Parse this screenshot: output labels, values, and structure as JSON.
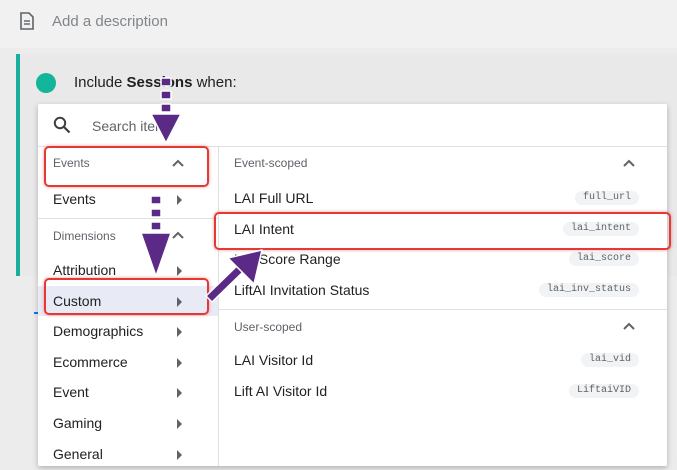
{
  "description": {
    "placeholder": "Add a description"
  },
  "condition": {
    "prefix": "Include ",
    "bold": "Sessions",
    "suffix": " when:"
  },
  "search": {
    "placeholder": "Search items"
  },
  "left": {
    "events_header": "Events",
    "events_item": "Events",
    "dimensions_header": "Dimensions",
    "items": [
      "Attribution",
      "Custom",
      "Demographics",
      "Ecommerce",
      "Event",
      "Gaming",
      "General"
    ],
    "selected": "Custom"
  },
  "right": {
    "event_scoped_header": "Event-scoped",
    "event_items": [
      {
        "label": "LAI Full URL",
        "chip": "full_url"
      },
      {
        "label": "LAI Intent",
        "chip": "lai_intent"
      },
      {
        "label": "LAI Score Range",
        "chip": "lai_score"
      },
      {
        "label": "LiftAI Invitation Status",
        "chip": "lai_inv_status"
      }
    ],
    "user_scoped_header": "User-scoped",
    "user_items": [
      {
        "label": "LAI Visitor Id",
        "chip": "lai_vid"
      },
      {
        "label": "Lift AI Visitor Id",
        "chip": "LiftaiVID"
      }
    ]
  },
  "colors": {
    "accent": "#1aae9f",
    "highlight_box": "#e53935",
    "arrow": "#5b2a86",
    "selected_bg": "#e8eaf6"
  },
  "icons": [
    "document-icon",
    "search-icon",
    "chevron-up-icon",
    "caret-right-icon"
  ]
}
